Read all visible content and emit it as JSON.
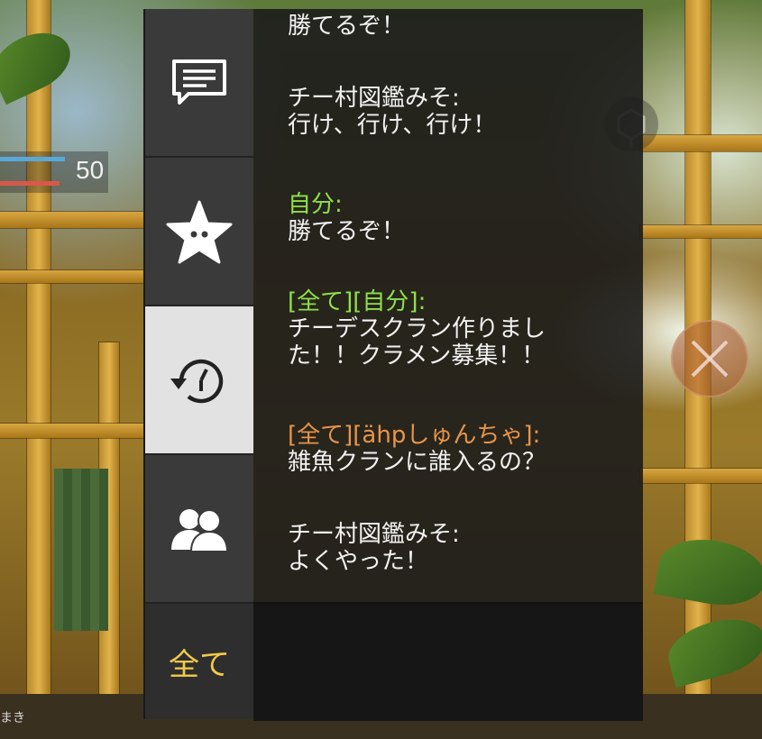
{
  "hud": {
    "health_value": "50",
    "health_fraction": 0.6,
    "armor_fraction": 0.55,
    "player_name": "まき"
  },
  "chat": {
    "tabs": {
      "messages_icon": "chat-bubble-icon",
      "favorites_icon": "star-icon",
      "history_icon": "history-clock-icon",
      "friends_icon": "friends-icon",
      "all_label": "全て"
    },
    "messages": [
      {
        "sender": "",
        "sender_color": "#f2f2f2",
        "body": "勝てるぞ！"
      },
      {
        "sender": "",
        "sender_color": "#f2f2f2",
        "body": "チー村図鑑みそ:\n行け、行け、行け！"
      },
      {
        "sender": "自分:",
        "sender_color": "#8ee04a",
        "body": "勝てるぞ！"
      },
      {
        "sender": "[全て][自分]:",
        "sender_color": "#8ee04a",
        "body": "チーデスクラン作りまし\nた！！クラメン募集！！"
      },
      {
        "sender": "[全て][ähpしゅんちゃ]:",
        "sender_color": "#e8944a",
        "body": "雑魚クランに誰入るの？"
      },
      {
        "sender": "",
        "sender_color": "#f2f2f2",
        "body": "チー村図鑑みそ:\nよくやった！"
      }
    ]
  },
  "colors": {
    "accent_yellow": "#f2c94a",
    "self_green": "#8ee04a",
    "other_orange": "#e8944a",
    "panel_bg": "#1c1c1c",
    "active_tab_bg": "#e2e2e2"
  }
}
